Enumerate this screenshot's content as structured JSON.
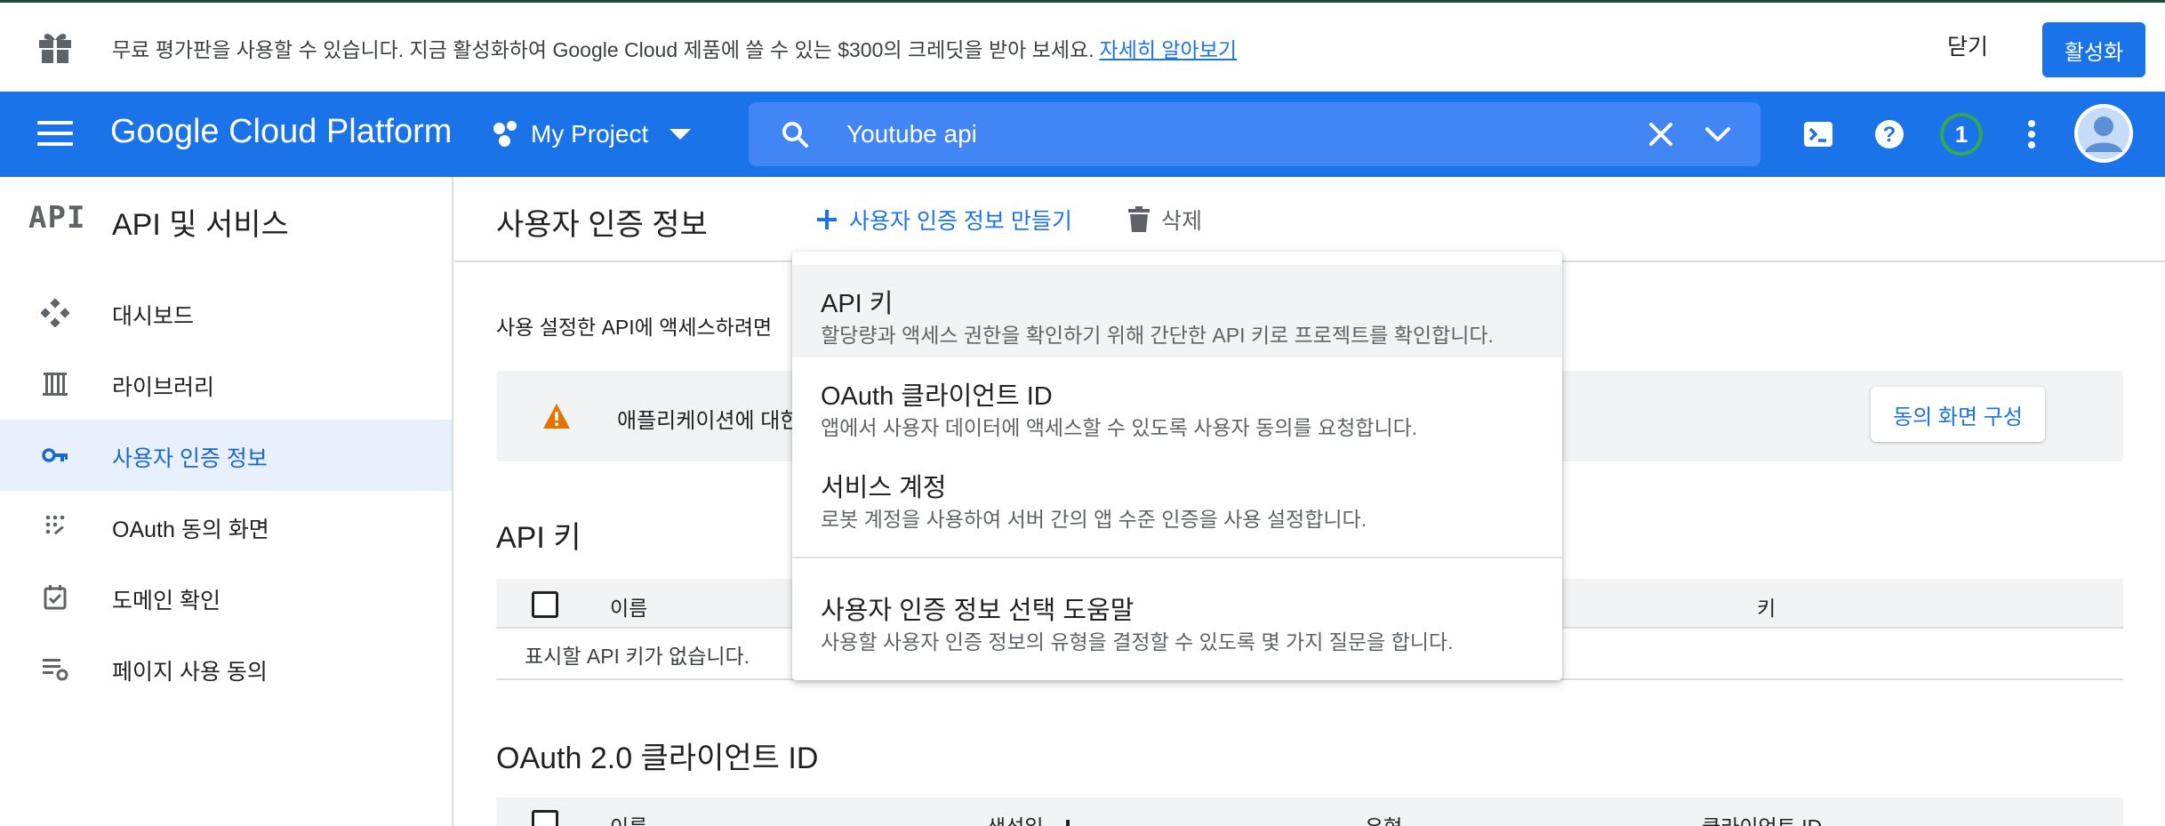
{
  "banner": {
    "message": "무료 평가판을 사용할 수 있습니다. 지금 활성화하여 Google Cloud 제품에 쓸 수 있는 $300의 크레딧을 받아 보세요.",
    "learn_more": "자세히 알아보기",
    "close_label": "닫기",
    "activate_label": "활성화",
    "icon": "gift-icon"
  },
  "topnav": {
    "brand": "Google Cloud Platform",
    "project": "My Project",
    "search_value": "Youtube api",
    "notification_count": "1",
    "accent_color": "#1a73e8"
  },
  "sidebar": {
    "logo_text": "API",
    "title": "API 및 서비스",
    "items": [
      {
        "label": "대시보드",
        "icon": "dashboard-icon"
      },
      {
        "label": "라이브러리",
        "icon": "library-icon"
      },
      {
        "label": "사용자 인증 정보",
        "icon": "key-icon",
        "active": true
      },
      {
        "label": "OAuth 동의 화면",
        "icon": "consent-screen-icon"
      },
      {
        "label": "도메인 확인",
        "icon": "domain-check-icon"
      },
      {
        "label": "페이지 사용 동의",
        "icon": "page-usage-icon"
      }
    ]
  },
  "main": {
    "title": "사용자 인증 정보",
    "create_label": "사용자 인증 정보 만들기",
    "delete_label": "삭제",
    "intro": "사용 설정한 API에 액세스하려면",
    "alert_text": "애플리케이션에 대한",
    "consent_button": "동의 화면 구성",
    "api_keys": {
      "title": "API 키",
      "columns": [
        "이름",
        "키"
      ],
      "empty": "표시할 API 키가 없습니다."
    },
    "oauth": {
      "title": "OAuth 2.0 클라이언트 ID",
      "columns": [
        "이름",
        "생성일",
        "유형",
        "클라이언트 ID"
      ]
    }
  },
  "dropdown": {
    "options": [
      {
        "title": "API 키",
        "desc": "할당량과 액세스 권한을 확인하기 위해 간단한 API 키로 프로젝트를 확인합니다."
      },
      {
        "title": "OAuth 클라이언트 ID",
        "desc": "앱에서 사용자 데이터에 액세스할 수 있도록 사용자 동의를 요청합니다."
      },
      {
        "title": "서비스 계정",
        "desc": "로봇 계정을 사용하여 서버 간의 앱 수준 인증을 사용 설정합니다."
      },
      {
        "title": "사용자 인증 정보 선택 도움말",
        "desc": "사용할 사용자 인증 정보의 유형을 결정할 수 있도록 몇 가지 질문을 합니다."
      }
    ]
  }
}
